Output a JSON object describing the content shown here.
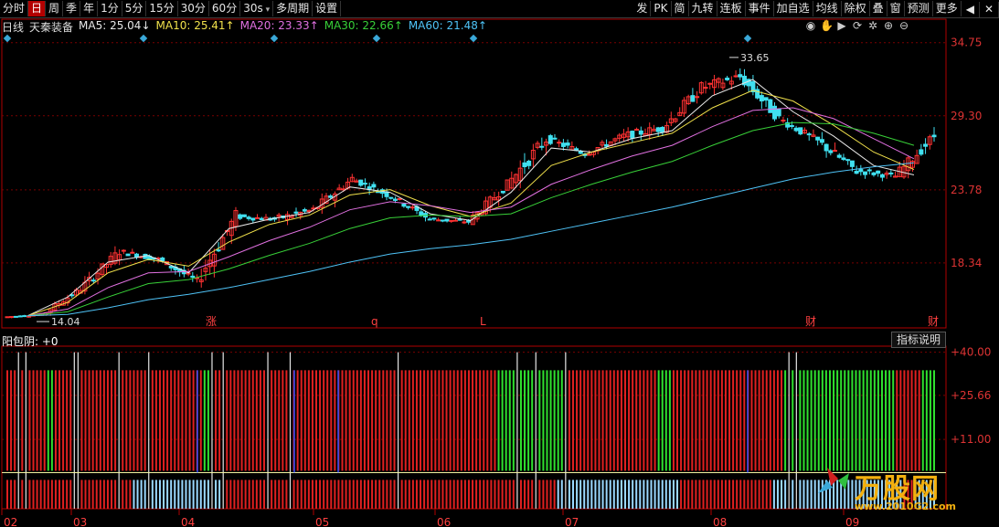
{
  "toolbar": {
    "left": [
      "分时",
      "日",
      "周",
      "季",
      "年",
      "1分",
      "5分",
      "15分",
      "30分",
      "60分",
      "30s",
      "多周期",
      "设置"
    ],
    "active": "日",
    "selects": [
      "30s"
    ],
    "right": [
      "发",
      "PK",
      "简",
      "九转",
      "连板",
      "事件",
      "加自选",
      "均线",
      "除权",
      "叠",
      "窗",
      "预测",
      "更多"
    ]
  },
  "legend": {
    "period": "日线",
    "stock": "天秦装备",
    "ma": [
      {
        "label": "MA5: 25.04↓",
        "color": "#e8e8e8"
      },
      {
        "label": "MA10: 25.41↑",
        "color": "#f1e14b"
      },
      {
        "label": "MA20: 23.33↑",
        "color": "#e070e0"
      },
      {
        "label": "MA30: 22.66↑",
        "color": "#38d038"
      },
      {
        "label": "MA60: 21.48↑",
        "color": "#4fc3f7"
      }
    ]
  },
  "colors": {
    "up": "#ff3232",
    "down": "#40e0f0",
    "grid": "#7a0000",
    "axis": "#b00000"
  },
  "chart_data": [
    {
      "type": "candlestick",
      "title": "天秦装备 日线",
      "ylabels": [
        "34.75",
        "29.30",
        "23.78",
        "18.34"
      ],
      "ylim": [
        13.5,
        36.5
      ],
      "xlabels": [
        "02",
        "03",
        "04",
        "05",
        "06",
        "07",
        "08",
        "09"
      ],
      "markers": [
        "涨",
        "q",
        "L",
        "财",
        "财"
      ],
      "annotations": [
        "33.65",
        "14.04"
      ],
      "ohlc_weekly_approx": [
        [
          14.3,
          14.8,
          14.04,
          14.5
        ],
        [
          14.5,
          16.8,
          14.4,
          16.4
        ],
        [
          16.4,
          19.8,
          16.0,
          19.2
        ],
        [
          19.2,
          20.2,
          18.0,
          18.6
        ],
        [
          18.6,
          19.0,
          16.3,
          17.0
        ],
        [
          17.0,
          22.5,
          16.5,
          21.8
        ],
        [
          21.8,
          22.6,
          20.5,
          21.6
        ],
        [
          21.6,
          23.8,
          20.9,
          22.3
        ],
        [
          22.3,
          25.8,
          22.0,
          24.6
        ],
        [
          24.6,
          25.4,
          22.8,
          23.3
        ],
        [
          23.3,
          23.6,
          21.0,
          21.6
        ],
        [
          21.6,
          22.3,
          20.8,
          21.4
        ],
        [
          21.4,
          24.8,
          21.2,
          24.2
        ],
        [
          24.2,
          29.5,
          23.8,
          27.6
        ],
        [
          27.6,
          28.5,
          25.8,
          26.5
        ],
        [
          26.5,
          29.2,
          26.2,
          27.8
        ],
        [
          27.8,
          30.2,
          26.8,
          28.4
        ],
        [
          28.4,
          32.8,
          28.0,
          31.4
        ],
        [
          31.4,
          33.65,
          29.6,
          32.2
        ],
        [
          32.2,
          32.8,
          28.5,
          29.1
        ],
        [
          29.1,
          29.8,
          26.6,
          27.4
        ],
        [
          27.4,
          28.2,
          24.0,
          25.2
        ],
        [
          25.2,
          25.8,
          23.4,
          24.8
        ],
        [
          24.8,
          29.0,
          24.6,
          27.8
        ]
      ],
      "series": [
        {
          "name": "MA5",
          "values": [
            14.4,
            15.8,
            18.4,
            18.9,
            17.6,
            20.9,
            21.6,
            22.1,
            24.0,
            23.6,
            22.0,
            21.5,
            23.6,
            26.9,
            26.6,
            27.6,
            28.2,
            30.8,
            32.0,
            29.6,
            27.8,
            25.6,
            24.9,
            25.04
          ]
        },
        {
          "name": "MA10",
          "values": [
            14.4,
            15.4,
            17.6,
            18.6,
            18.1,
            19.9,
            21.2,
            21.9,
            23.4,
            23.8,
            22.6,
            21.8,
            22.8,
            25.6,
            26.6,
            27.3,
            28.0,
            29.9,
            31.2,
            30.4,
            28.6,
            26.6,
            25.3,
            25.41
          ]
        },
        {
          "name": "MA20",
          "values": [
            14.4,
            14.9,
            16.5,
            17.6,
            17.7,
            18.8,
            20.0,
            21.0,
            22.3,
            22.9,
            22.6,
            22.1,
            22.5,
            24.2,
            25.3,
            26.3,
            27.1,
            28.5,
            29.7,
            29.9,
            29.1,
            27.6,
            26.1,
            23.33
          ]
        },
        {
          "name": "MA30",
          "values": [
            14.4,
            14.7,
            15.8,
            16.8,
            17.1,
            17.9,
            18.9,
            19.8,
            20.9,
            21.7,
            21.9,
            21.8,
            22.0,
            23.2,
            24.2,
            25.1,
            25.9,
            27.1,
            28.2,
            28.8,
            28.7,
            28.0,
            27.1,
            22.66
          ]
        },
        {
          "name": "MA60",
          "values": [
            14.4,
            14.5,
            15.0,
            15.6,
            16.0,
            16.5,
            17.1,
            17.7,
            18.4,
            19.0,
            19.4,
            19.7,
            20.1,
            20.7,
            21.3,
            21.9,
            22.5,
            23.2,
            23.9,
            24.6,
            25.1,
            25.5,
            25.8,
            21.48
          ]
        }
      ]
    },
    {
      "type": "bar",
      "title": "阳包阴: +0",
      "ylabels": [
        "+40.00",
        "+25.66",
        "+11.00"
      ],
      "ylim": [
        -12,
        42
      ],
      "bar_count": 250,
      "white_line_bars": [
        3,
        5,
        18,
        19,
        30,
        38,
        55,
        58,
        70,
        76,
        105,
        137,
        142,
        150,
        210,
        212,
        253,
        255
      ],
      "green_upper_ranges": [
        [
          11,
          12
        ],
        [
          53,
          54
        ],
        [
          132,
          150
        ],
        [
          175,
          178
        ],
        [
          209,
          238
        ],
        [
          246,
          253
        ]
      ],
      "blue_lower_ranges": [
        [
          34,
          58
        ],
        [
          148,
          180
        ],
        [
          206,
          240
        ],
        [
          244,
          255
        ]
      ]
    }
  ]
}
